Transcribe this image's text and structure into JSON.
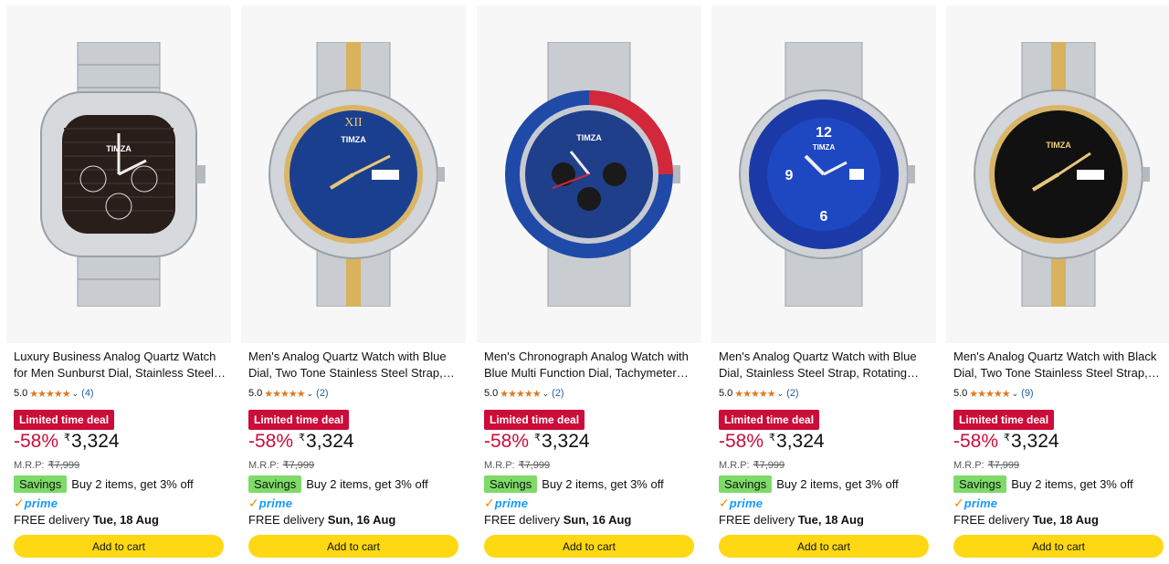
{
  "colors": {
    "deal_bg": "#cc0c39",
    "discount": "#cc0c39",
    "savings_bg": "#7fda69",
    "prime_blue": "#1399ff",
    "prime_check": "#f08804",
    "star": "#de7921",
    "review_link": "#2162a1",
    "cart_button": "#ffd814"
  },
  "products": [
    {
      "title": "Luxury Business Analog Quartz Watch for Men Sunburst Dial, Stainless Steel Strap, Day and Date Display",
      "brand_on_dial": "TIMZA",
      "dial_color": "#2a1e1a",
      "rating": "5.0",
      "stars": "★★★★★",
      "reviews": "(4)",
      "deal": "Limited time deal",
      "discount": "-58%",
      "currency": "₹",
      "price": "3,324",
      "mrp_label": "M.R.P:",
      "mrp": "₹7,999",
      "savings_badge": "Savings",
      "savings_text": "Buy 2 items, get 3% off",
      "prime": "prime",
      "delivery_prefix": "FREE delivery",
      "delivery_date": "Tue, 18 Aug",
      "cart": "Add to cart"
    },
    {
      "title": "Men's Analog Quartz Watch with Blue Dial, Two Tone Stainless Steel Strap, Day and Date Display",
      "brand_on_dial": "TIMZA",
      "dial_color": "#1b3f8f",
      "rating": "5.0",
      "stars": "★★★★★",
      "reviews": "(2)",
      "deal": "Limited time deal",
      "discount": "-58%",
      "currency": "₹",
      "price": "3,324",
      "mrp_label": "M.R.P:",
      "mrp": "₹7,999",
      "savings_badge": "Savings",
      "savings_text": "Buy 2 items, get 3% off",
      "prime": "prime",
      "delivery_prefix": "FREE delivery",
      "delivery_date": "Sun, 16 Aug",
      "cart": "Add to cart"
    },
    {
      "title": "Men's Chronograph Analog Watch with Blue Multi Function Dial, Tachymeter Bezel",
      "brand_on_dial": "TIMZA",
      "dial_color": "#1f3f8a",
      "rating": "5.0",
      "stars": "★★★★★",
      "reviews": "(2)",
      "deal": "Limited time deal",
      "discount": "-58%",
      "currency": "₹",
      "price": "3,324",
      "mrp_label": "M.R.P:",
      "mrp": "₹7,999",
      "savings_badge": "Savings",
      "savings_text": "Buy 2 items, get 3% off",
      "prime": "prime",
      "delivery_prefix": "FREE delivery",
      "delivery_date": "Sun, 16 Aug",
      "cart": "Add to cart"
    },
    {
      "title": "Men's Analog Quartz Watch with Blue Dial, Stainless Steel Strap, Rotating Bezel, Date Display",
      "brand_on_dial": "TIMZA",
      "dial_color": "#1b3aa8",
      "rating": "5.0",
      "stars": "★★★★★",
      "reviews": "(2)",
      "deal": "Limited time deal",
      "discount": "-58%",
      "currency": "₹",
      "price": "3,324",
      "mrp_label": "M.R.P:",
      "mrp": "₹7,999",
      "savings_badge": "Savings",
      "savings_text": "Buy 2 items, get 3% off",
      "prime": "prime",
      "delivery_prefix": "FREE delivery",
      "delivery_date": "Tue, 18 Aug",
      "cart": "Add to cart"
    },
    {
      "title": "Men's Analog Quartz Watch with Black Dial, Two Tone Stainless Steel Strap, Day and Date Display",
      "brand_on_dial": "TIMZA",
      "dial_color": "#111111",
      "rating": "5.0",
      "stars": "★★★★★",
      "reviews": "(9)",
      "deal": "Limited time deal",
      "discount": "-58%",
      "currency": "₹",
      "price": "3,324",
      "mrp_label": "M.R.P:",
      "mrp": "₹7,999",
      "savings_badge": "Savings",
      "savings_text": "Buy 2 items, get 3% off",
      "prime": "prime",
      "delivery_prefix": "FREE delivery",
      "delivery_date": "Tue, 18 Aug",
      "cart": "Add to cart"
    }
  ]
}
